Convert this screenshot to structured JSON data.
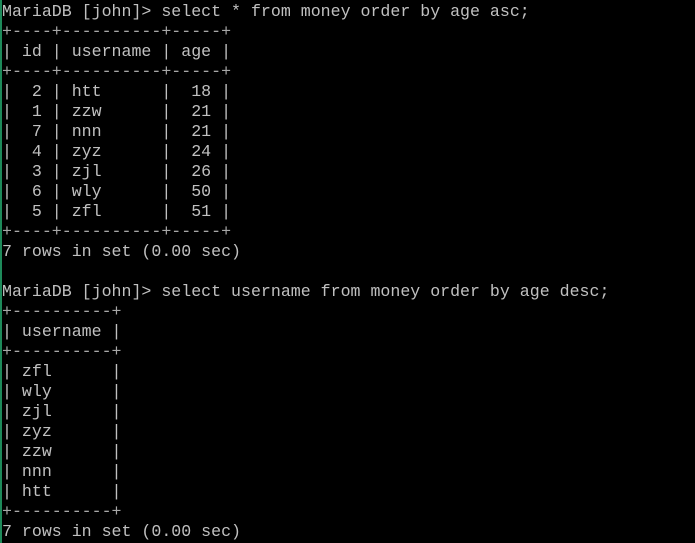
{
  "terminal": {
    "prompt": "MariaDB [john]> ",
    "colors": {
      "background": "#000000",
      "text": "#c0c0c0",
      "left_edge": "#1e8a5a"
    },
    "blocks": [
      {
        "command": "select * from money order by age asc;",
        "columns": [
          "id",
          "username",
          "age"
        ],
        "align": [
          "right",
          "left",
          "right"
        ],
        "rows": [
          [
            "2",
            "htt",
            "18"
          ],
          [
            "1",
            "zzw",
            "21"
          ],
          [
            "7",
            "nnn",
            "21"
          ],
          [
            "4",
            "zyz",
            "24"
          ],
          [
            "3",
            "zjl",
            "26"
          ],
          [
            "6",
            "wly",
            "50"
          ],
          [
            "5",
            "zfl",
            "51"
          ]
        ],
        "status": "7 rows in set (0.00 sec)"
      },
      {
        "command": "select username from money order by age desc;",
        "columns": [
          "username"
        ],
        "align": [
          "left"
        ],
        "rows": [
          [
            "zfl"
          ],
          [
            "wly"
          ],
          [
            "zjl"
          ],
          [
            "zyz"
          ],
          [
            "zzw"
          ],
          [
            "nnn"
          ],
          [
            "htt"
          ]
        ],
        "status": "7 rows in set (0.00 sec)"
      }
    ]
  }
}
